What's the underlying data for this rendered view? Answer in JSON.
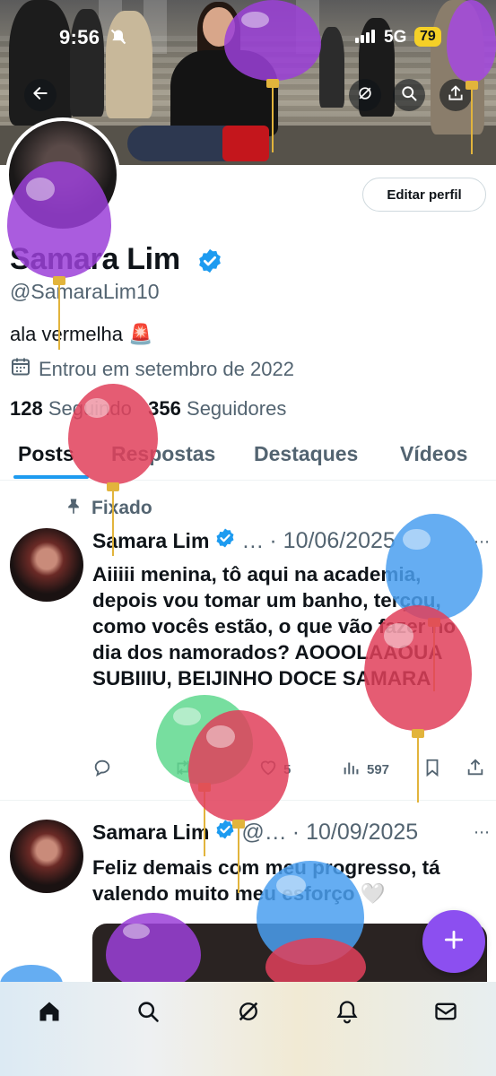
{
  "status_bar": {
    "time": "9:56",
    "network": "5G",
    "battery": "79"
  },
  "profile": {
    "display_name": "Samara Lim",
    "handle": "@SamaraLim10",
    "bio": "ala vermelha 🚨",
    "joined": "Entrou em setembro de 2022",
    "following_count": "128",
    "following_label": "Seguindo",
    "followers_count": "356",
    "followers_label": "Seguidores",
    "edit_button": "Editar perfil"
  },
  "tabs": [
    "Posts",
    "Respostas",
    "Destaques",
    "Vídeos"
  ],
  "posts": [
    {
      "pinned_label": "Fixado",
      "author": "Samara Lim",
      "handle_trunc": "…",
      "date": "· 10/06/2025",
      "text": "Aiiiii menina, tô aqui na academia, depois vou tomar um banho, terçou, como vocês estão, o que vão fazer no dia dos namorados? AOOOLAAOUA SUBIIIU, BEIJINHO DOCE SAMARA",
      "replies": "",
      "reposts": "",
      "likes": "5",
      "views": "597"
    },
    {
      "author": "Samara Lim",
      "handle_trunc": "@…",
      "date": "· 10/09/2025",
      "text": "Feliz demais com meu progresso, tá valendo muito meu esforço 🤍"
    }
  ],
  "colors": {
    "accent": "#1d9bf0",
    "fab": "#8c4ff0",
    "balloon_purple": "#9b3fd8",
    "balloon_red": "#e0405a",
    "balloon_blue": "#4a9ff0",
    "balloon_green": "#5fd88e"
  },
  "icons": {
    "back": "arrow-left-icon",
    "grok": "grok-icon",
    "search": "search-icon",
    "share": "share-icon",
    "verified": "verified-badge-icon",
    "calendar": "calendar-icon",
    "pin": "pin-icon",
    "fab": "plus-icon",
    "nav": [
      "home-icon",
      "search-icon",
      "grok-icon",
      "bell-icon",
      "mail-icon"
    ]
  }
}
